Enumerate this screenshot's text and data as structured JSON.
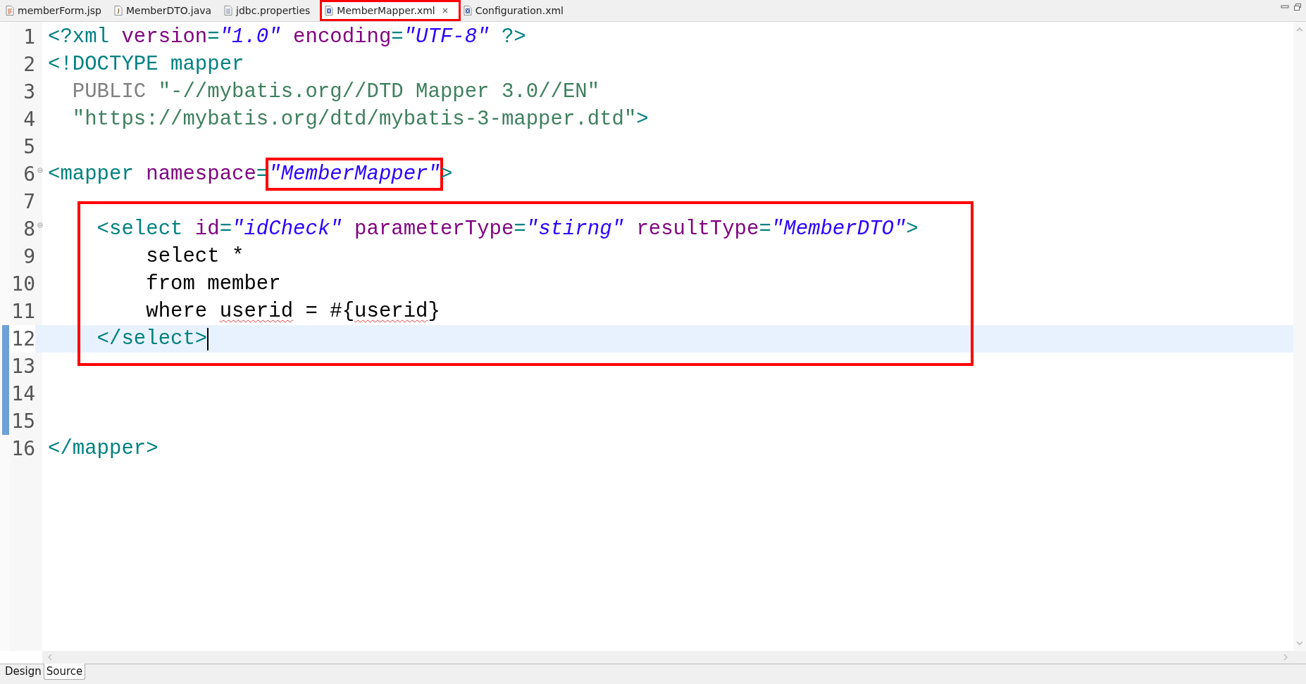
{
  "tabs": [
    {
      "label": "memberForm.jsp",
      "kind": "jsp",
      "selected": false,
      "highlighted": false
    },
    {
      "label": "MemberDTO.java",
      "kind": "java",
      "selected": false,
      "highlighted": false
    },
    {
      "label": "jdbc.properties",
      "kind": "text",
      "selected": false,
      "highlighted": false
    },
    {
      "label": "MemberMapper.xml",
      "kind": "xml",
      "selected": true,
      "highlighted": true
    },
    {
      "label": "Configuration.xml",
      "kind": "xml",
      "selected": false,
      "highlighted": false
    }
  ],
  "lines": [
    {
      "number": "1",
      "tokens": [
        {
          "kind": "tag",
          "text": "<?xml"
        },
        {
          "kind": "attr",
          "text": " version"
        },
        {
          "kind": "tag",
          "text": "="
        },
        {
          "kind": "value",
          "text": "\"1.0\""
        },
        {
          "kind": "attr",
          "text": " encoding"
        },
        {
          "kind": "tag",
          "text": "="
        },
        {
          "kind": "value",
          "text": "\"UTF-8\""
        },
        {
          "kind": "tag",
          "text": " ?>"
        }
      ]
    },
    {
      "number": "2",
      "tokens": [
        {
          "kind": "tag",
          "text": "<!DOCTYPE mapper"
        }
      ]
    },
    {
      "number": "3",
      "tokens": [
        {
          "kind": "keyword",
          "text": "  PUBLIC"
        },
        {
          "kind": "string",
          "text": " \"-//mybatis.org//DTD Mapper 3.0//EN\""
        }
      ]
    },
    {
      "number": "4",
      "tokens": [
        {
          "kind": "string",
          "text": "  \"https://mybatis.org/dtd/mybatis-3-mapper.dtd\""
        },
        {
          "kind": "tag",
          "text": ">"
        }
      ]
    },
    {
      "number": "5"
    },
    {
      "number": "6",
      "foldable": true,
      "tokens": [
        {
          "kind": "tag",
          "text": "<mapper"
        },
        {
          "kind": "attr",
          "text": " namespace"
        },
        {
          "kind": "tag",
          "text": "="
        },
        {
          "kind": "value",
          "text": "\"MemberMapper\"",
          "highlighted": true
        },
        {
          "kind": "tag",
          "text": ">"
        }
      ]
    },
    {
      "number": "7"
    },
    {
      "number": "8",
      "foldable": true,
      "boxed": true,
      "tokens": [
        {
          "kind": "tag",
          "text": "    <select"
        },
        {
          "kind": "attr",
          "text": " id"
        },
        {
          "kind": "tag",
          "text": "="
        },
        {
          "kind": "value",
          "text": "\"idCheck\""
        },
        {
          "kind": "attr",
          "text": " parameterType"
        },
        {
          "kind": "tag",
          "text": "="
        },
        {
          "kind": "value",
          "text": "\"stirng\""
        },
        {
          "kind": "attr",
          "text": " resultType"
        },
        {
          "kind": "tag",
          "text": "="
        },
        {
          "kind": "value",
          "text": "\"MemberDTO\""
        },
        {
          "kind": "tag",
          "text": ">"
        }
      ]
    },
    {
      "number": "9",
      "boxed": true,
      "tokens": [
        {
          "kind": "plain",
          "text": "        select *"
        }
      ]
    },
    {
      "number": "10",
      "boxed": true,
      "tokens": [
        {
          "kind": "plain",
          "text": "        from member"
        }
      ]
    },
    {
      "number": "11",
      "boxed": true,
      "tokens": [
        {
          "kind": "plain",
          "text": "        where "
        },
        {
          "kind": "plain",
          "text": "userid",
          "misspelled": true
        },
        {
          "kind": "plain",
          "text": " = #{"
        },
        {
          "kind": "plain",
          "text": "userid",
          "misspelled": true
        },
        {
          "kind": "plain",
          "text": "}"
        }
      ]
    },
    {
      "number": "12",
      "boxed": true,
      "current": true,
      "changed": true,
      "tokens": [
        {
          "kind": "tag",
          "text": "    </select>"
        }
      ]
    },
    {
      "number": "13",
      "changed": true
    },
    {
      "number": "14",
      "changed": true
    },
    {
      "number": "15",
      "changed": true
    },
    {
      "number": "16",
      "tokens": [
        {
          "kind": "tag",
          "text": "</mapper>"
        }
      ]
    }
  ],
  "bottom_tabs": [
    {
      "label": "Design",
      "selected": false
    },
    {
      "label": "Source",
      "selected": true
    }
  ]
}
